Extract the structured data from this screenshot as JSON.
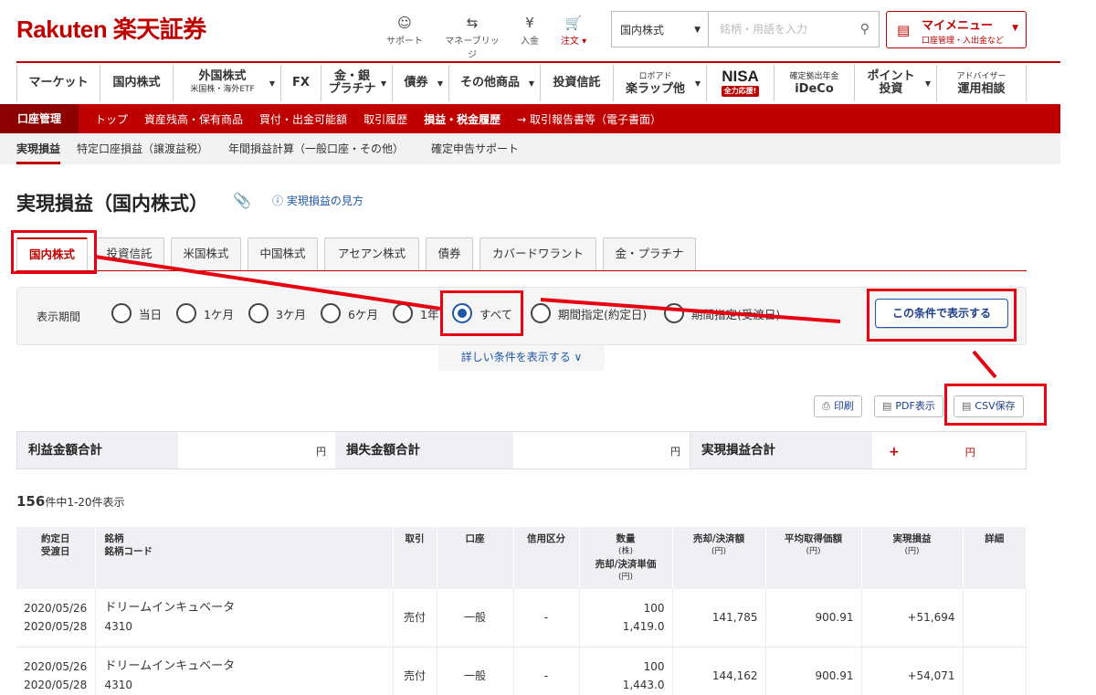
{
  "header": {
    "logo": "Rakuten 楽天証券",
    "icons": [
      {
        "glyph": "☺",
        "label": "サポート",
        "icon": "support-icon"
      },
      {
        "glyph": "⇆",
        "label": "マネーブリッジ",
        "icon": "bank-icon"
      },
      {
        "glyph": "¥",
        "label": "入金",
        "icon": "deposit-icon"
      },
      {
        "glyph": "🛒",
        "label": "注文 ▾",
        "icon": "cart-icon"
      }
    ],
    "search_category": "国内株式",
    "search_placeholder": "銘柄・用語を入力",
    "mymenu_title": "マイメニュー",
    "mymenu_sub": "口座管理・入出金など"
  },
  "main_nav": [
    {
      "label": "マーケット",
      "sub": ""
    },
    {
      "label": "国内株式",
      "sub": ""
    },
    {
      "label": "外国株式",
      "sub": "米国株・海外ETF"
    },
    {
      "label": "FX",
      "sub": ""
    },
    {
      "label": "金・銀",
      "sub": "プラチナ"
    },
    {
      "label": "債券",
      "sub": ""
    },
    {
      "label": "その他商品",
      "sub": ""
    },
    {
      "label": "投資信託",
      "sub": ""
    },
    {
      "label": "ロボアド",
      "sub": "楽ラップ他"
    },
    {
      "label": "NISA",
      "sub": "全力応援!"
    },
    {
      "label": "確定拠出年金",
      "sub": "iDeCo"
    },
    {
      "label": "ポイント",
      "sub": "投資"
    },
    {
      "label": "アドバイザー",
      "sub": "運用相談"
    }
  ],
  "account_bar": {
    "section": "口座管理",
    "links": [
      "トップ",
      "資産残高・保有商品",
      "買付・出金可能額",
      "取引履歴",
      "損益・税金履歴",
      "→ 取引報告書等（電子書面）"
    ]
  },
  "sub_bar": [
    "実現損益",
    "特定口座損益（譲渡益税）",
    "年間損益計算（一般口座・その他）",
    "確定申告サポート"
  ],
  "page": {
    "title": "実現損益（国内株式）",
    "help": "実現損益の見方"
  },
  "tabs": [
    "国内株式",
    "投資信託",
    "米国株式",
    "中国株式",
    "アセアン株式",
    "債券",
    "カバードワラント",
    "金・プラチナ"
  ],
  "filter": {
    "label": "表示期間",
    "options": [
      "当日",
      "1ケ月",
      "3ケ月",
      "6ケ月",
      "1年",
      "すべて",
      "期間指定(約定日)",
      "期間指定(受渡日)"
    ],
    "selected": "すべて",
    "show_button": "この条件で表示する",
    "detail_link": "詳しい条件を表示する ∨"
  },
  "actions": {
    "print": "印刷",
    "pdf": "PDF表示",
    "csv": "CSV保存"
  },
  "summary": {
    "profit_label": "利益金額合計",
    "profit_unit": "円",
    "loss_label": "損失金額合計",
    "loss_unit": "円",
    "realized_label": "実現損益合計",
    "realized_sign": "+",
    "realized_unit": "円"
  },
  "count": {
    "total": "156",
    "text": "件中1-20件表示"
  },
  "table": {
    "headers": {
      "date1": "約定日",
      "date2": "受渡日",
      "name1": "銘柄",
      "name2": "銘柄コード",
      "trade": "取引",
      "account": "口座",
      "credit": "信用区分",
      "qty1": "数量",
      "qty2": "(株)",
      "qty3": "売却/決済単価",
      "qty4": "(円)",
      "amount1": "売却/決済額",
      "amount2": "(円)",
      "avg1": "平均取得価額",
      "avg2": "(円)",
      "pl1": "実現損益",
      "pl2": "(円)",
      "detail": "詳細"
    },
    "rows": [
      {
        "date1": "2020/05/26",
        "date2": "2020/05/28",
        "name": "ドリームインキュベータ",
        "code": "4310",
        "trade": "売付",
        "account": "一般",
        "credit": "-",
        "qty": "100",
        "price": "1,419.0",
        "amount": "141,785",
        "avg": "900.91",
        "pl": "+51,694"
      },
      {
        "date1": "2020/05/26",
        "date2": "2020/05/28",
        "name": "ドリームインキュベータ",
        "code": "4310",
        "trade": "売付",
        "account": "一般",
        "credit": "-",
        "qty": "100",
        "price": "1,443.0",
        "amount": "144,162",
        "avg": "900.91",
        "pl": "+54,071"
      }
    ]
  },
  "colors": {
    "brand": "#bf0000",
    "link": "#1d58a8",
    "annotation": "#e60012"
  }
}
